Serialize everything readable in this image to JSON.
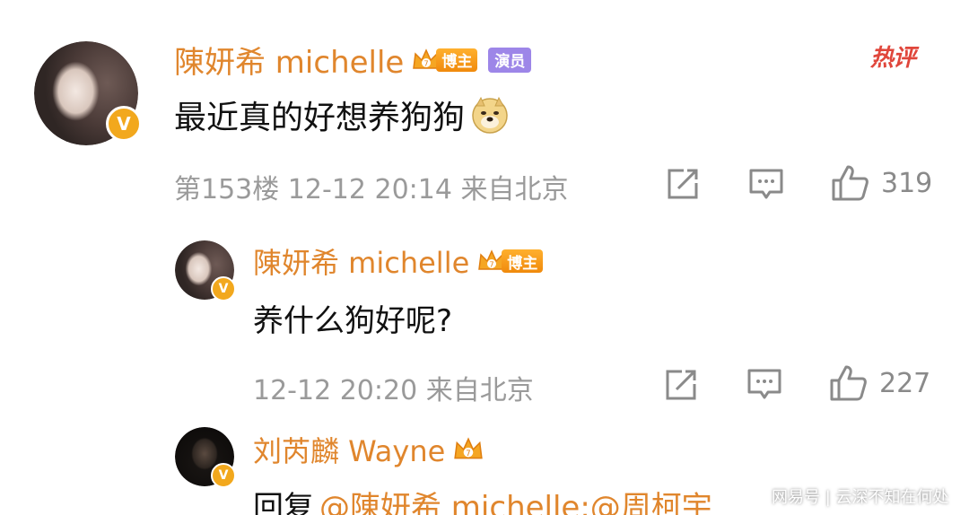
{
  "comments": [
    {
      "username": "陳妍希 michelle",
      "badge_blogger": "博主",
      "badge_actor": "演员",
      "text": "最近真的好想养狗狗",
      "emoji": "doge-emoji",
      "meta": "第153楼 12-12 20:14 来自北京",
      "likes": "319",
      "hot_label": "热评"
    },
    {
      "username": "陳妍希 michelle",
      "badge_blogger": "博主",
      "text": "养什么狗好呢?",
      "meta": "12-12 20:20 来自北京",
      "likes": "227"
    },
    {
      "username": "刘芮麟 Wayne",
      "reply_prefix": "回复",
      "reply_mention": "@陳妍希 michelle:@周柯宇"
    }
  ],
  "icons": {
    "verified": "v-verified-icon",
    "crown": "crown-icon",
    "share": "share-icon",
    "comment": "comment-icon",
    "like": "thumbs-up-icon"
  },
  "verified_glyph": "V",
  "watermark": "网易号 | 云深不知在何处",
  "colors": {
    "username": "#e0862d",
    "verified": "#f2a81d",
    "actor_tag": "#9d86e8",
    "hot": "#e0463b",
    "meta": "#9a9a9a"
  }
}
